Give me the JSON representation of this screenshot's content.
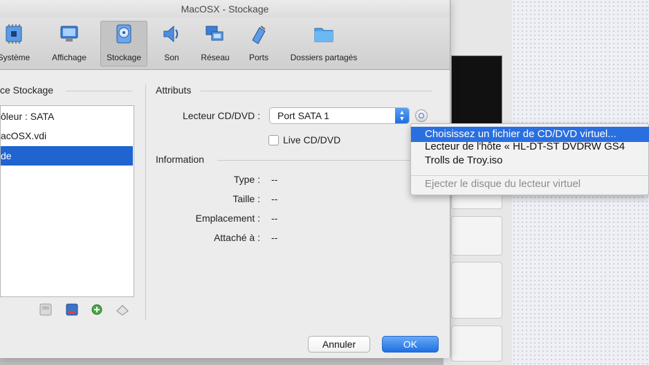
{
  "window": {
    "title": "MacOSX - Stockage"
  },
  "toolbar": {
    "items": [
      {
        "label": "Système",
        "icon": "system-chip-icon"
      },
      {
        "label": "Affichage",
        "icon": "display-monitor-icon"
      },
      {
        "label": "Stockage",
        "icon": "storage-disk-icon",
        "selected": true
      },
      {
        "label": "Son",
        "icon": "speaker-icon"
      },
      {
        "label": "Réseau",
        "icon": "network-icon"
      },
      {
        "label": "Ports",
        "icon": "ports-icon"
      },
      {
        "label": "Dossiers partagés",
        "icon": "shared-folder-icon"
      }
    ]
  },
  "storage_tree": {
    "title": "ce Stockage",
    "items": [
      {
        "label": "ôleur : SATA"
      },
      {
        "label": "acOSX.vdi"
      },
      {
        "label": "de",
        "selected": true
      }
    ],
    "tools": [
      "add-controller-icon",
      "remove-controller-icon",
      "add-attachment-icon",
      "remove-attachment-icon"
    ]
  },
  "attributes": {
    "title": "Attributs",
    "drive_label": "Lecteur CD/DVD :",
    "drive_value": "Port SATA 1",
    "live_cd_label": "Live CD/DVD",
    "live_cd_checked": false
  },
  "information": {
    "title": "Information",
    "rows": [
      {
        "label": "Type :",
        "value": "--"
      },
      {
        "label": "Taille :",
        "value": "--"
      },
      {
        "label": "Emplacement :",
        "value": "--"
      },
      {
        "label": "Attaché à :",
        "value": "--"
      }
    ]
  },
  "popup_menu": {
    "items": [
      {
        "label": "Choisissez un fichier de CD/DVD virtuel...",
        "active": true
      },
      {
        "label": "Lecteur de l'hôte « HL-DT-ST DVDRW  GS4"
      },
      {
        "label": "Trolls de Troy.iso"
      },
      {
        "label": "Ejecter le disque du lecteur virtuel",
        "disabled": true
      }
    ]
  },
  "buttons": {
    "cancel": "Annuler",
    "ok": "OK"
  },
  "colors": {
    "accent": "#1f64d0",
    "selection": "#2a6fe0"
  }
}
